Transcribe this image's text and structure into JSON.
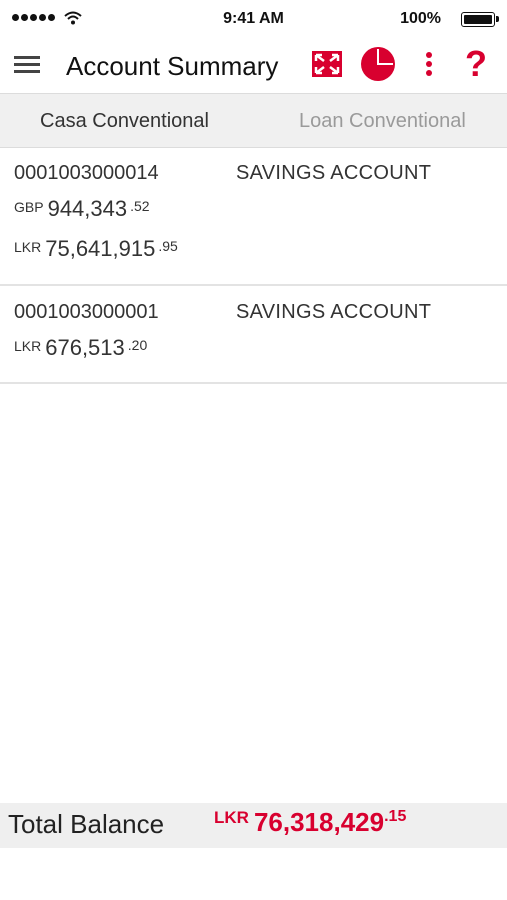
{
  "status_bar": {
    "time": "9:41 AM",
    "battery": "100%"
  },
  "header": {
    "title": "Account Summary",
    "icons": [
      "menu-icon",
      "expand-icon",
      "pie-chart-icon",
      "more-icon",
      "help-icon"
    ],
    "help_glyph": "?"
  },
  "tabs": [
    {
      "label": "Casa Conventional",
      "active": true
    },
    {
      "label": "Loan Conventional",
      "active": false
    }
  ],
  "accounts": [
    {
      "number": "0001003000014",
      "type": "SAVINGS ACCOUNT",
      "balances": [
        {
          "currency": "GBP",
          "amount": "944,343",
          "decimals": ".52"
        },
        {
          "currency": "LKR",
          "amount": "75,641,915",
          "decimals": ".95"
        }
      ]
    },
    {
      "number": "0001003000001",
      "type": "SAVINGS ACCOUNT",
      "balances": [
        {
          "currency": "LKR",
          "amount": "676,513",
          "decimals": ".20"
        }
      ]
    }
  ],
  "total": {
    "label": "Total Balance",
    "currency": "LKR",
    "amount": "76,318,429",
    "decimals": ".15"
  },
  "colors": {
    "accent": "#d8002f",
    "tab_bar": "#f0f0f0",
    "total_bar": "#efefef"
  }
}
